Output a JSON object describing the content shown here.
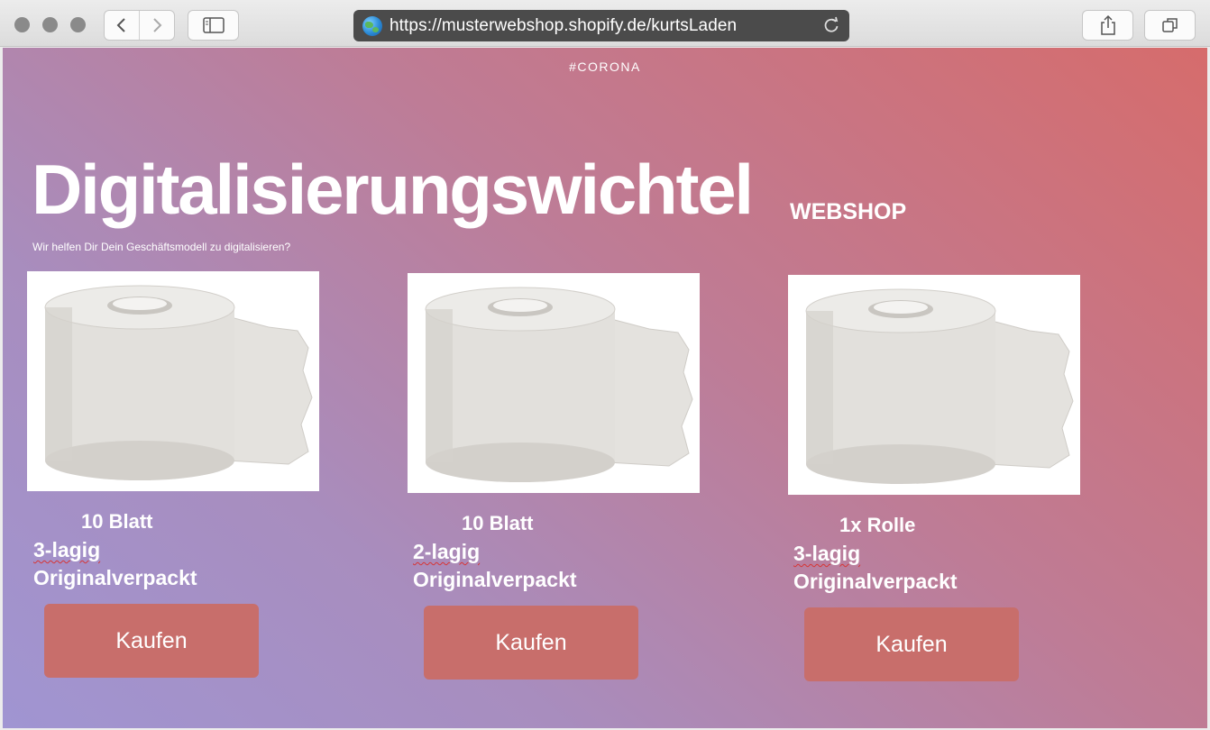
{
  "browser": {
    "url": "https://musterwebshop.shopify.de/kurtsLaden"
  },
  "page": {
    "hashtag": "#CORONA",
    "brand": "Digitalisierungswichtel",
    "brand_suffix": "WEBSHOP",
    "tagline": "Wir helfen Dir Dein Geschäftsmodell zu digitalisieren?"
  },
  "products": [
    {
      "title": "10 Blatt",
      "layers": "3-lagig",
      "packaging": "Originalverpackt",
      "button": "Kaufen"
    },
    {
      "title": "10 Blatt",
      "layers": "2-lagig",
      "packaging": "Originalverpackt",
      "button": "Kaufen"
    },
    {
      "title": "1x Rolle",
      "layers": "3-lagig",
      "packaging": "Originalverpackt",
      "button": "Kaufen"
    }
  ],
  "colors": {
    "button_bg": "#c86e6b",
    "gradient_start": "#a095d2",
    "gradient_end": "#d66c6c"
  }
}
